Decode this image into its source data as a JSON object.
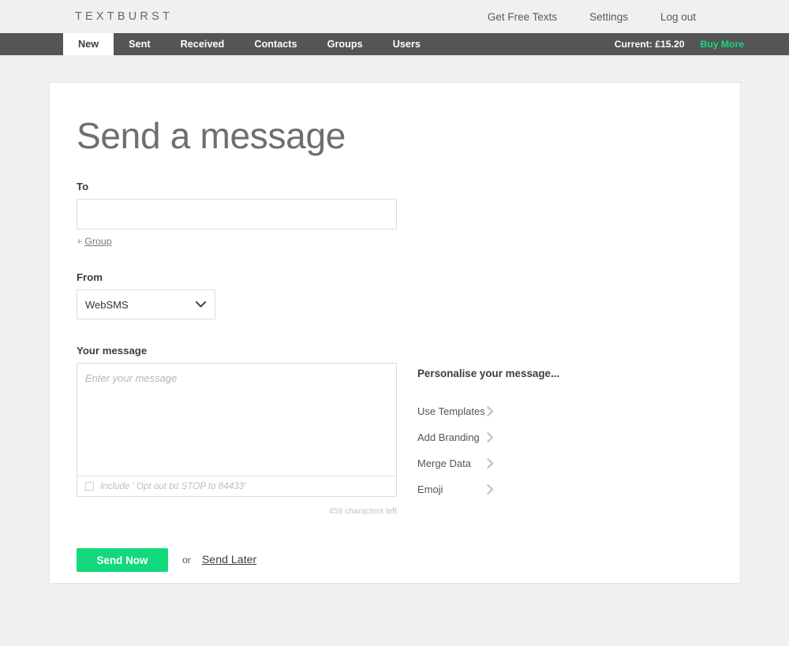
{
  "header": {
    "logo": "TEXTBURST",
    "nav": [
      {
        "label": "Get Free Texts"
      },
      {
        "label": "Settings"
      },
      {
        "label": "Log out"
      }
    ]
  },
  "navbar": {
    "tabs": [
      {
        "label": "New",
        "active": true
      },
      {
        "label": "Sent",
        "active": false
      },
      {
        "label": "Received",
        "active": false
      },
      {
        "label": "Contacts",
        "active": false
      },
      {
        "label": "Groups",
        "active": false
      },
      {
        "label": "Users",
        "active": false
      }
    ],
    "credit_label": "Current: £15.20",
    "buy_more_label": "Buy More",
    "background_color": "#555555",
    "buy_more_color": "#14d97e"
  },
  "main": {
    "title": "Send a message",
    "to": {
      "label": "To",
      "value": "",
      "placeholder": ""
    },
    "group_link": {
      "plus": "+",
      "label": "Group"
    },
    "from": {
      "label": "From",
      "selected": "WebSMS",
      "options": [
        "WebSMS"
      ]
    },
    "message": {
      "label": "Your message",
      "value": "",
      "placeholder": "Enter your message",
      "optout_label": "Include ' Opt out txt STOP to 84433'",
      "optout_checked": false,
      "characters_left": "459 characters left"
    },
    "personalise": {
      "title": "Personalise your message...",
      "items": [
        {
          "label": "Use Templates"
        },
        {
          "label": "Add Branding"
        },
        {
          "label": "Merge Data"
        },
        {
          "label": "Emoji"
        }
      ]
    },
    "actions": {
      "send_now": "Send Now",
      "or": "or",
      "send_later": "Send Later",
      "send_now_color": "#12d97d"
    }
  }
}
